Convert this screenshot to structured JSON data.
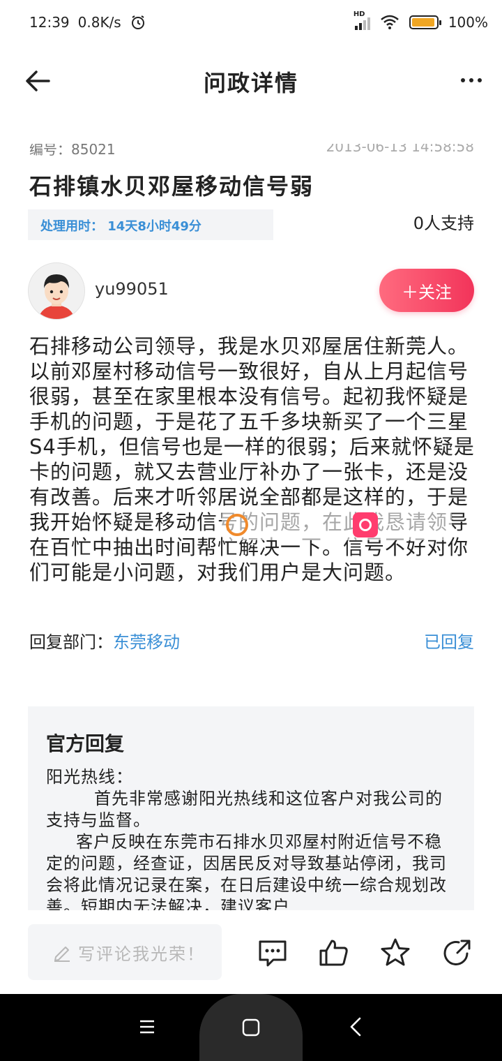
{
  "status_bar": {
    "time": "12:39",
    "speed": "0.8K/s",
    "network": "HD",
    "battery_pct": "100%",
    "battery_level": 1.0
  },
  "header": {
    "title": "问政详情"
  },
  "meta": {
    "number": "编号：85021",
    "date": "2013-06-13 14:58:58"
  },
  "post": {
    "title": "石排镇水贝邓屋移动信号弱",
    "time_used": "处理用时：  14天8小时49分",
    "supporters": "0人支持",
    "body": "石排移动公司领导，我是水贝邓屋居住新莞人。以前邓屋村移动信号一致很好，自从上月起信号很弱，甚至在家里根本没有信号。起初我怀疑是手机的问题，于是花了五千多块新买了一个三星S4手机，但信号也是一样的很弱；后来就怀疑是卡的问题，就又去营业厅补办了一张卡，还是没有改善。后来才听邻居说全部都是这样的，于是我开始怀疑是移动信号的问题，在此我恳请领导在百忙中抽出时间帮忙解决一下。信号不好对你们可能是小问题，对我们用户是大问题。"
  },
  "user": {
    "name": "yu99051",
    "follow_label": "＋关注"
  },
  "reply": {
    "dept_label": "回复部门：",
    "dept_name": "东莞移动",
    "status": "已回复"
  },
  "official": {
    "title": "官方回复",
    "body": "阳光热线：\n        首先非常感谢阳光热线和这位客户对我公司的支持与监督。\n     客户反映在东莞市石排水贝邓屋村附近信号不稳定的问题，经查证，因居民反对导致基站停闭，我司会将此情况记录在案，在日后建设中统一综合规划改善。短期内无法解决，建议客户"
  },
  "actionbar": {
    "comment_placeholder": "写评论我光荣！"
  },
  "colors": {
    "accent_blue": "#3a8fd6",
    "follow_pink": "#f2345a",
    "battery_orange": "#f0a623"
  }
}
